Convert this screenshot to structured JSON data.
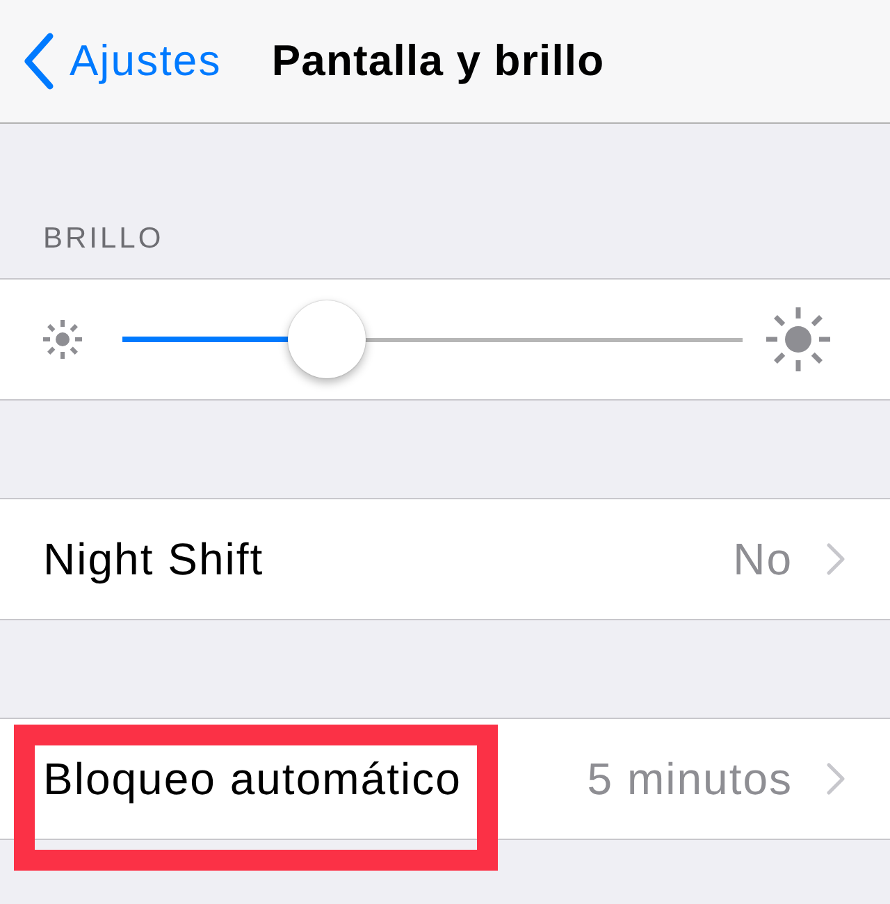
{
  "nav_bar": {
    "back_label": "Ajustes",
    "title": "Pantalla y brillo"
  },
  "sections": [
    {
      "header": "BRILLO",
      "rows": [
        {
          "kind": "slider",
          "level": 0.33
        }
      ]
    },
    {
      "rows": [
        {
          "kind": "disclosure",
          "label": "Night Shift",
          "value": "No",
          "highlighted": false
        }
      ]
    },
    {
      "rows": [
        {
          "kind": "disclosure",
          "label": "Bloqueo automático",
          "value": "5 minutos",
          "highlighted": true
        }
      ]
    }
  ]
}
